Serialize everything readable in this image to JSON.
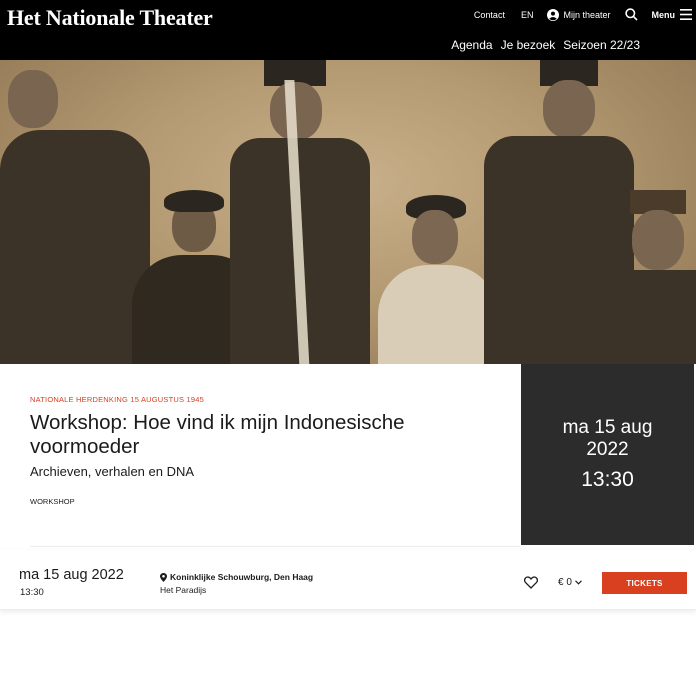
{
  "header": {
    "logo": "Het Nationale Theater",
    "utility": {
      "contact": "Contact",
      "language": "EN",
      "account": "Mijn theater",
      "menu": "Menu"
    },
    "nav": [
      "Agenda",
      "Je bezoek",
      "Seizoen 22/23"
    ]
  },
  "event": {
    "eyebrow": "NATIONALE HERDENKING 15 AUGUSTUS 1945",
    "title": "Workshop: Hoe vind ik mijn Indonesische voormoeder",
    "subtitle": "Archieven, verhalen en DNA",
    "tag": "WORKSHOP",
    "datebox": {
      "line1": "ma 15 aug",
      "line2": "2022",
      "time": "13:30"
    }
  },
  "ticket_row": {
    "date": "ma 15 aug 2022",
    "time": "13:30",
    "venue": "Koninklijke Schouwburg, Den Haag",
    "room": "Het Paradijs",
    "price": "€ 0",
    "button": "TICKETS"
  },
  "colors": {
    "accent": "#d8401f",
    "header_bg": "#000000",
    "datebox_bg": "#2c2c2c"
  }
}
